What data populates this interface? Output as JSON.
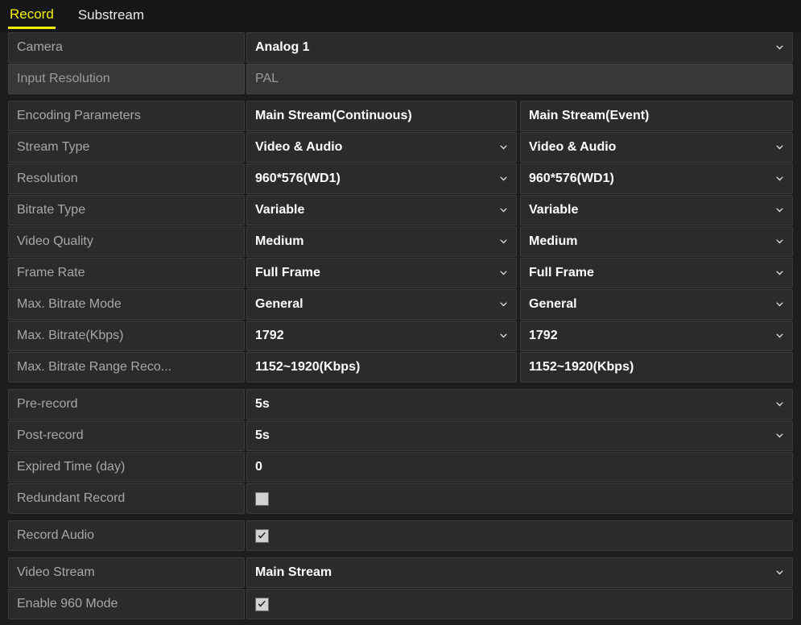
{
  "tabs": [
    {
      "label": "Record",
      "active": true
    },
    {
      "label": "Substream",
      "active": false
    }
  ],
  "colors": {
    "accent": "#f5f000",
    "background": "#1d1d1d",
    "row_background": "#2b2b2b",
    "disabled_background": "#383838",
    "label_text": "#a8a8a8",
    "value_text": "#ffffff"
  },
  "icons": {
    "chevron_down": "chevron-down-icon",
    "checkmark": "check-icon"
  },
  "groups": [
    {
      "name": "camera-group",
      "rows": [
        {
          "id": "camera",
          "label": "Camera",
          "type": "dropdown",
          "value": "Analog 1",
          "disabled": false
        },
        {
          "id": "input-resolution",
          "label": "Input Resolution",
          "type": "readonly",
          "value": "PAL",
          "disabled": true
        }
      ]
    },
    {
      "name": "encoding-group",
      "rows": [
        {
          "id": "encoding-parameters",
          "label": "Encoding Parameters",
          "type": "dual-header",
          "value_left": "Main Stream(Continuous)",
          "value_right": "Main Stream(Event)"
        },
        {
          "id": "stream-type",
          "label": "Stream Type",
          "type": "dual-dropdown",
          "value_left": "Video & Audio",
          "value_right": "Video & Audio"
        },
        {
          "id": "resolution",
          "label": "Resolution",
          "type": "dual-dropdown",
          "value_left": "960*576(WD1)",
          "value_right": "960*576(WD1)"
        },
        {
          "id": "bitrate-type",
          "label": "Bitrate Type",
          "type": "dual-dropdown",
          "value_left": "Variable",
          "value_right": "Variable"
        },
        {
          "id": "video-quality",
          "label": "Video Quality",
          "type": "dual-dropdown",
          "value_left": "Medium",
          "value_right": "Medium"
        },
        {
          "id": "frame-rate",
          "label": "Frame Rate",
          "type": "dual-dropdown",
          "value_left": "Full Frame",
          "value_right": "Full Frame"
        },
        {
          "id": "max-bitrate-mode",
          "label": "Max. Bitrate Mode",
          "type": "dual-dropdown",
          "value_left": "General",
          "value_right": "General"
        },
        {
          "id": "max-bitrate-kbps",
          "label": "Max. Bitrate(Kbps)",
          "type": "dual-dropdown",
          "value_left": "1792",
          "value_right": "1792"
        },
        {
          "id": "max-bitrate-range",
          "label": "Max. Bitrate Range Reco...",
          "type": "dual-readonly",
          "value_left": "1152~1920(Kbps)",
          "value_right": "1152~1920(Kbps)"
        }
      ]
    },
    {
      "name": "record-settings-group",
      "rows": [
        {
          "id": "pre-record",
          "label": "Pre-record",
          "type": "dropdown",
          "value": "5s"
        },
        {
          "id": "post-record",
          "label": "Post-record",
          "type": "dropdown",
          "value": "5s"
        },
        {
          "id": "expired-time",
          "label": "Expired Time (day)",
          "type": "text",
          "value": "0"
        },
        {
          "id": "redundant-record",
          "label": "Redundant Record",
          "type": "checkbox",
          "checked": false
        }
      ]
    },
    {
      "name": "audio-group",
      "rows": [
        {
          "id": "record-audio",
          "label": "Record Audio",
          "type": "checkbox",
          "checked": true
        }
      ]
    },
    {
      "name": "video-stream-group",
      "rows": [
        {
          "id": "video-stream",
          "label": "Video Stream",
          "type": "dropdown",
          "value": "Main Stream"
        },
        {
          "id": "enable-960-mode",
          "label": "Enable 960 Mode",
          "type": "checkbox",
          "checked": true
        }
      ]
    }
  ]
}
